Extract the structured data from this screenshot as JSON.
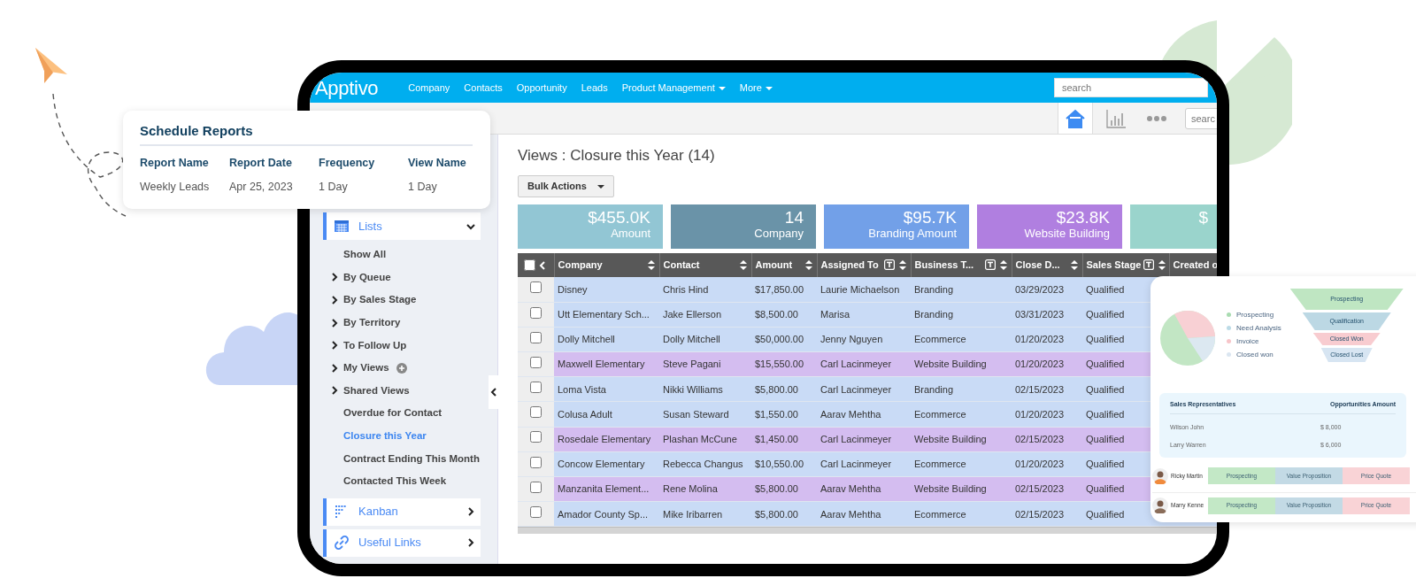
{
  "schedule_card": {
    "title": "Schedule Reports",
    "columns": [
      "Report Name",
      "Report Date",
      "Frequency",
      "View Name"
    ],
    "row": [
      "Weekly Leads",
      "Apr 25, 2023",
      "1 Day",
      "1 Day"
    ]
  },
  "navbar": {
    "logo": "Apptivo",
    "menu": [
      {
        "label": "Company",
        "dropdown": false
      },
      {
        "label": "Contacts",
        "dropdown": false
      },
      {
        "label": "Opportunity",
        "dropdown": false
      },
      {
        "label": "Leads",
        "dropdown": false
      },
      {
        "label": "Product Management",
        "dropdown": true
      },
      {
        "label": "More",
        "dropdown": true
      }
    ],
    "search": {
      "placeholder": "search"
    }
  },
  "toolbar": {
    "buttons": [
      {
        "kind": "home",
        "selected": true
      },
      {
        "kind": "chart",
        "selected": false
      },
      {
        "kind": "more",
        "selected": false
      }
    ],
    "search": {
      "placeholder": "searc"
    }
  },
  "sidebar": {
    "sections": [
      {
        "label": "Lists",
        "kind": "calendar",
        "expanded": true,
        "items": [
          {
            "label": "Show All",
            "kind": "link",
            "selected": false
          },
          {
            "label": "By Queue",
            "kind": "folder",
            "selected": false
          },
          {
            "label": "By Sales Stage",
            "kind": "folder",
            "selected": false
          },
          {
            "label": "By Territory",
            "kind": "folder",
            "selected": false
          },
          {
            "label": "To Follow Up",
            "kind": "folder",
            "selected": false
          },
          {
            "label": "My Views",
            "kind": "folder_add",
            "selected": false
          },
          {
            "label": "Shared Views",
            "kind": "folder",
            "selected": false
          },
          {
            "label": "Overdue for Contact",
            "kind": "link",
            "selected": false
          },
          {
            "label": "Closure this Year",
            "kind": "link",
            "selected": true
          },
          {
            "label": "Contract Ending This Month",
            "kind": "link",
            "selected": false
          },
          {
            "label": "Contacted This Week",
            "kind": "link",
            "selected": false
          }
        ]
      },
      {
        "label": "Kanban",
        "kind": "kanban",
        "expanded": false
      },
      {
        "label": "Useful Links",
        "kind": "link",
        "expanded": false
      }
    ]
  },
  "main": {
    "title": "Views : Closure this Year (14)",
    "bulk_actions": "Bulk Actions",
    "tiles": [
      {
        "value": "$455.0K",
        "label": "Amount",
        "color": "#92c6d4"
      },
      {
        "value": "14",
        "label": "Company",
        "color": "#6a93a8"
      },
      {
        "value": "$95.7K",
        "label": "Branding Amount",
        "color": "#72a0e8"
      },
      {
        "value": "$23.8K",
        "label": "Website Building",
        "color": "#b07fe0"
      },
      {
        "value": "$",
        "color": "#9ad4cc"
      }
    ],
    "table": {
      "all_checked": false,
      "columns": [
        {
          "label": "Company",
          "filter": false,
          "sortable": true
        },
        {
          "label": "Contact",
          "filter": false,
          "sortable": true
        },
        {
          "label": "Amount",
          "filter": false,
          "sortable": true
        },
        {
          "label": "Assigned To",
          "filter": true,
          "sortable": true
        },
        {
          "label": "Business T...",
          "filter": true,
          "sortable": true
        },
        {
          "label": "Close D...",
          "filter": false,
          "sortable": true
        },
        {
          "label": "Sales Stage",
          "filter": true,
          "sortable": true
        },
        {
          "label": "Created o"
        }
      ],
      "rows": [
        {
          "checked": false,
          "color": "#c9dbf6",
          "cells": [
            "Disney",
            "Chris Hind",
            "$17,850.00",
            "Laurie Michaelson",
            "Branding",
            "03/29/2023",
            "Qualified"
          ]
        },
        {
          "checked": false,
          "color": "#c9dbf6",
          "cells": [
            "Utt Elementary Sch...",
            "Jake Ellerson",
            "$8,500.00",
            "Marisa",
            "Branding",
            "03/31/2023",
            "Qualified"
          ]
        },
        {
          "checked": false,
          "color": "#c9dbf6",
          "cells": [
            "Dolly Mitchell",
            "Dolly Mitchell",
            "$50,000.00",
            "Jenny Nguyen",
            "Ecommerce",
            "01/20/2023",
            "Qualified"
          ]
        },
        {
          "checked": false,
          "color": "#d4bdf0",
          "cells": [
            "Maxwell Elementary",
            "Steve Pagani",
            "$15,550.00",
            "Carl Lacinmeyer",
            "Website Building",
            "01/20/2023",
            "Qualified"
          ]
        },
        {
          "checked": false,
          "color": "#c9dbf6",
          "cells": [
            "Loma Vista",
            "Nikki Williams",
            "$5,800.00",
            "Carl Lacinmeyer",
            "Branding",
            "02/15/2023",
            "Qualified"
          ]
        },
        {
          "checked": false,
          "color": "#c9dbf6",
          "cells": [
            "Colusa Adult",
            "Susan Steward",
            "$1,550.00",
            "Aarav Mehtha",
            "Ecommerce",
            "01/20/2023",
            "Qualified"
          ]
        },
        {
          "checked": false,
          "color": "#d4bdf0",
          "cells": [
            "Rosedale Elementary",
            "Plashan McCune",
            "$1,450.00",
            "Carl Lacinmeyer",
            "Website Building",
            "02/15/2023",
            "Qualified"
          ]
        },
        {
          "checked": false,
          "color": "#c9dbf6",
          "cells": [
            "Concow Elementary",
            "Rebecca Changus",
            "$10,550.00",
            "Carl Lacinmeyer",
            "Ecommerce",
            "01/20/2023",
            "Qualified"
          ]
        },
        {
          "checked": false,
          "color": "#d4bdf0",
          "cells": [
            "Manzanita Element...",
            "Rene Molina",
            "$5,800.00",
            "Aarav Mehtha",
            "Website Building",
            "02/15/2023",
            "Qualified"
          ]
        },
        {
          "checked": false,
          "color": "#c9dbf6",
          "cells": [
            "Amador County Sp...",
            "Mike Iribarren",
            "$5,800.00",
            "Aarav Mehtha",
            "Ecommerce",
            "02/15/2023",
            "Qualified"
          ]
        }
      ]
    }
  },
  "insights_card": {
    "legend": [
      {
        "label": "Prospecting",
        "color": "#a9dcb1"
      },
      {
        "label": "Need Analysis",
        "color": "#bcdbe7"
      },
      {
        "label": "Invoice",
        "color": "#f7c5c9"
      },
      {
        "label": "Closed won",
        "color": "#dbe6f1"
      }
    ],
    "funnel": [
      {
        "label": "Prospecting",
        "color": "#bfe6c2"
      },
      {
        "label": "Qualification",
        "color": "#bcd8e4"
      },
      {
        "label": "Closed Won",
        "color": "#f8ccd0"
      },
      {
        "label": "Closed Lost",
        "color": "#d7e5f2"
      }
    ],
    "reps": {
      "columns": [
        "Sales Representatives",
        "Opportunities Amount"
      ],
      "rows": [
        [
          "Wilson John",
          "$ 8,000"
        ],
        [
          "Larry Warren",
          "$ 6,000"
        ]
      ]
    },
    "pipeline": [
      {
        "name": "Ricky Martin",
        "stages": [
          {
            "label": "Prospecting",
            "color": "#c3e8c6"
          },
          {
            "label": "Value Proposition",
            "color": "#c3dae5"
          },
          {
            "label": "Price Quote",
            "color": "#f9d3d6"
          }
        ]
      },
      {
        "name": "Marry Kenne",
        "stages": [
          {
            "label": "Prospecting",
            "color": "#c3e8c6"
          },
          {
            "label": "Value Proposition",
            "color": "#c3dae5"
          },
          {
            "label": "Price Quote",
            "color": "#f9d3d6"
          }
        ]
      }
    ]
  }
}
